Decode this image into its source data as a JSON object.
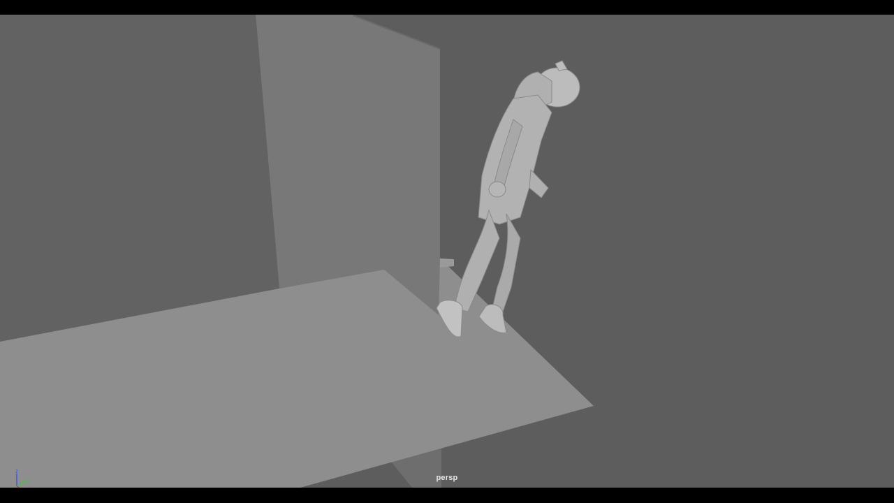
{
  "viewport": {
    "camera_label": "persp",
    "background_color": "#5d5d5d",
    "letterbox_color": "#000000"
  },
  "axis_gizmo": {
    "z_label": "z",
    "y_label": "y",
    "x_color": "#d23c3c",
    "y_color": "#3cc83c",
    "z_color": "#3c5adc"
  },
  "scene": {
    "objects": [
      "back-wall",
      "front-wall",
      "floor-platform",
      "support-column",
      "hooded-character"
    ]
  }
}
